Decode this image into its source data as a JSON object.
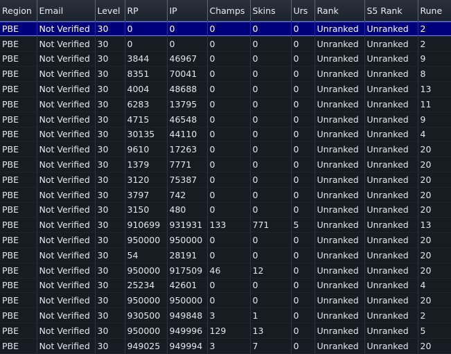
{
  "table": {
    "headers": [
      "Region",
      "Email",
      "Level",
      "RP",
      "IP",
      "Champs",
      "Skins",
      "Urs",
      "Rank",
      "S5 Rank",
      "Rune"
    ],
    "rows": [
      [
        "PBE",
        "Not Verified",
        "30",
        "0",
        "0",
        "0",
        "0",
        "0",
        "Unranked",
        "Unranked",
        "2"
      ],
      [
        "PBE",
        "Not Verified",
        "30",
        "0",
        "0",
        "0",
        "0",
        "0",
        "Unranked",
        "Unranked",
        "2"
      ],
      [
        "PBE",
        "Not Verified",
        "30",
        "3844",
        "46967",
        "0",
        "0",
        "0",
        "Unranked",
        "Unranked",
        "9"
      ],
      [
        "PBE",
        "Not Verified",
        "30",
        "8351",
        "70041",
        "0",
        "0",
        "0",
        "Unranked",
        "Unranked",
        "8"
      ],
      [
        "PBE",
        "Not Verified",
        "30",
        "4004",
        "48688",
        "0",
        "0",
        "0",
        "Unranked",
        "Unranked",
        "13"
      ],
      [
        "PBE",
        "Not Verified",
        "30",
        "6283",
        "13795",
        "0",
        "0",
        "0",
        "Unranked",
        "Unranked",
        "11"
      ],
      [
        "PBE",
        "Not Verified",
        "30",
        "4715",
        "46548",
        "0",
        "0",
        "0",
        "Unranked",
        "Unranked",
        "9"
      ],
      [
        "PBE",
        "Not Verified",
        "30",
        "30135",
        "44110",
        "0",
        "0",
        "0",
        "Unranked",
        "Unranked",
        "4"
      ],
      [
        "PBE",
        "Not Verified",
        "30",
        "9610",
        "17263",
        "0",
        "0",
        "0",
        "Unranked",
        "Unranked",
        "20"
      ],
      [
        "PBE",
        "Not Verified",
        "30",
        "1379",
        "7771",
        "0",
        "0",
        "0",
        "Unranked",
        "Unranked",
        "20"
      ],
      [
        "PBE",
        "Not Verified",
        "30",
        "3120",
        "75387",
        "0",
        "0",
        "0",
        "Unranked",
        "Unranked",
        "20"
      ],
      [
        "PBE",
        "Not Verified",
        "30",
        "3797",
        "742",
        "0",
        "0",
        "0",
        "Unranked",
        "Unranked",
        "20"
      ],
      [
        "PBE",
        "Not Verified",
        "30",
        "3150",
        "480",
        "0",
        "0",
        "0",
        "Unranked",
        "Unranked",
        "20"
      ],
      [
        "PBE",
        "Not Verified",
        "30",
        "910699",
        "931931",
        "133",
        "771",
        "5",
        "Unranked",
        "Unranked",
        "13"
      ],
      [
        "PBE",
        "Not Verified",
        "30",
        "950000",
        "950000",
        "0",
        "0",
        "0",
        "Unranked",
        "Unranked",
        "20"
      ],
      [
        "PBE",
        "Not Verified",
        "30",
        "54",
        "28191",
        "0",
        "0",
        "0",
        "Unranked",
        "Unranked",
        "20"
      ],
      [
        "PBE",
        "Not Verified",
        "30",
        "950000",
        "917509",
        "46",
        "12",
        "0",
        "Unranked",
        "Unranked",
        "20"
      ],
      [
        "PBE",
        "Not Verified",
        "30",
        "25234",
        "42601",
        "0",
        "0",
        "0",
        "Unranked",
        "Unranked",
        "4"
      ],
      [
        "PBE",
        "Not Verified",
        "30",
        "950000",
        "950000",
        "0",
        "0",
        "0",
        "Unranked",
        "Unranked",
        "20"
      ],
      [
        "PBE",
        "Not Verified",
        "30",
        "930500",
        "949848",
        "3",
        "1",
        "0",
        "Unranked",
        "Unranked",
        "2"
      ],
      [
        "PBE",
        "Not Verified",
        "30",
        "950000",
        "949996",
        "129",
        "13",
        "0",
        "Unranked",
        "Unranked",
        "5"
      ],
      [
        "PBE",
        "Not Verified",
        "30",
        "949025",
        "949994",
        "3",
        "7",
        "0",
        "Unranked",
        "Unranked",
        "20"
      ]
    ]
  }
}
